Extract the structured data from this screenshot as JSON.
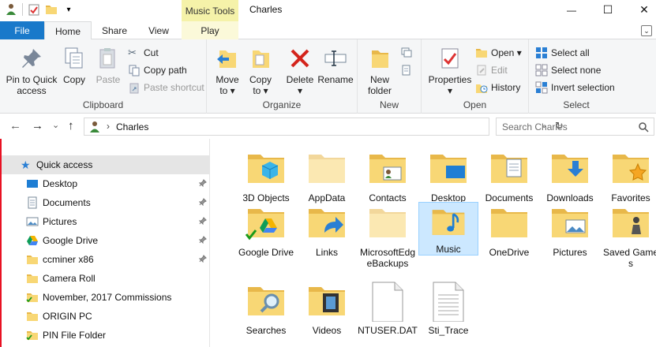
{
  "window": {
    "title": "Charles",
    "context_tab_group": "Music Tools",
    "buttons": {
      "minimize": "—",
      "maximize": "☐",
      "close": "✕"
    }
  },
  "qat": {
    "dropdown": "▾"
  },
  "tabs": {
    "file": "File",
    "home": "Home",
    "share": "Share",
    "view": "View",
    "play": "Play"
  },
  "ribbon": {
    "clipboard": {
      "label": "Clipboard",
      "pin": "Pin to Quick access",
      "copy": "Copy",
      "paste": "Paste",
      "cut": "Cut",
      "copy_path": "Copy path",
      "paste_shortcut": "Paste shortcut"
    },
    "organize": {
      "label": "Organize",
      "move_to": "Move to ▾",
      "copy_to": "Copy to ▾",
      "delete": "Delete ▾",
      "rename": "Rename"
    },
    "new": {
      "label": "New",
      "new_folder": "New folder"
    },
    "open": {
      "label": "Open",
      "properties": "Properties ▾",
      "open": "Open ▾",
      "edit": "Edit",
      "history": "History"
    },
    "select": {
      "label": "Select",
      "select_all": "Select all",
      "select_none": "Select none",
      "invert": "Invert selection"
    }
  },
  "address": {
    "back": "←",
    "forward": "→",
    "recent": "⌄",
    "up": "↑",
    "path_sep": "›",
    "path": "Charles",
    "dropdown": "⌄",
    "refresh": "↻"
  },
  "search": {
    "placeholder": "Search Charles"
  },
  "nav": {
    "quick_access": "Quick access",
    "items": [
      {
        "label": "Desktop",
        "pinned": true
      },
      {
        "label": "Documents",
        "pinned": true
      },
      {
        "label": "Pictures",
        "pinned": true
      },
      {
        "label": "Google Drive",
        "pinned": true
      },
      {
        "label": "ccminer x86",
        "pinned": true
      },
      {
        "label": "Camera Roll",
        "pinned": false
      },
      {
        "label": "November, 2017 Commissions",
        "pinned": false
      },
      {
        "label": "ORIGIN PC",
        "pinned": false
      },
      {
        "label": "PIN File Folder",
        "pinned": false
      }
    ]
  },
  "content": {
    "items": [
      {
        "label": "3D Objects"
      },
      {
        "label": "AppData"
      },
      {
        "label": "Contacts"
      },
      {
        "label": "Desktop"
      },
      {
        "label": "Documents"
      },
      {
        "label": "Downloads"
      },
      {
        "label": "Favorites"
      },
      {
        "label": "Google Drive"
      },
      {
        "label": "Links"
      },
      {
        "label": "MicrosoftEdgeBackups"
      },
      {
        "label": "Music",
        "selected": true
      },
      {
        "label": "OneDrive"
      },
      {
        "label": "Pictures"
      },
      {
        "label": "Saved Games"
      },
      {
        "label": "Searches"
      },
      {
        "label": "Videos"
      },
      {
        "label": "NTUSER.DAT"
      },
      {
        "label": "Sti_Trace"
      }
    ]
  },
  "colors": {
    "file_tab": "#1979ca",
    "context_tab": "#f5f2a9",
    "selection": "#cce8ff",
    "folder": "#f8d775"
  }
}
